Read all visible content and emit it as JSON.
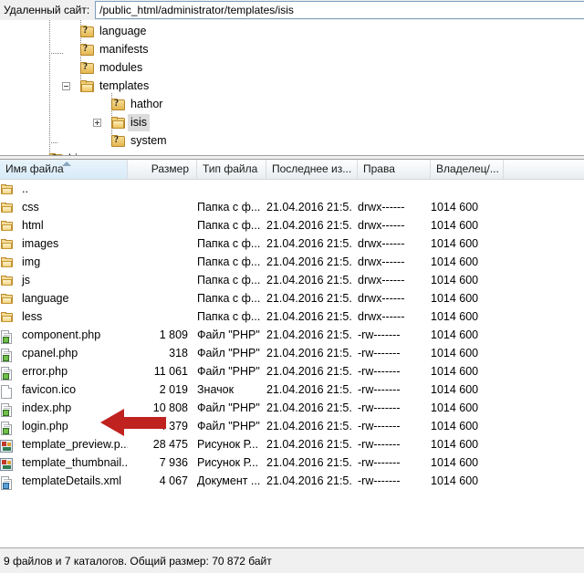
{
  "pathbar": {
    "label": "Удаленный сайт:",
    "value": "/public_html/administrator/templates/isis"
  },
  "tree": {
    "items": [
      {
        "label": "language",
        "icon": "folder-unknown-icon",
        "depth": 2,
        "expander": "none",
        "selected": false
      },
      {
        "label": "manifests",
        "icon": "folder-unknown-icon",
        "depth": 2,
        "expander": "none",
        "selected": false
      },
      {
        "label": "modules",
        "icon": "folder-unknown-icon",
        "depth": 2,
        "expander": "none",
        "selected": false
      },
      {
        "label": "templates",
        "icon": "folder-icon",
        "depth": 2,
        "expander": "minus",
        "selected": false
      },
      {
        "label": "hathor",
        "icon": "folder-unknown-icon",
        "depth": 3,
        "expander": "none",
        "selected": false
      },
      {
        "label": "isis",
        "icon": "folder-icon",
        "depth": 3,
        "expander": "plus",
        "selected": true
      },
      {
        "label": "system",
        "icon": "folder-unknown-icon",
        "depth": 3,
        "expander": "none",
        "selected": false
      },
      {
        "label": "bin",
        "icon": "folder-unknown-icon",
        "depth": 1,
        "expander": "none",
        "selected": false
      }
    ]
  },
  "list": {
    "columns": [
      {
        "key": "name",
        "label": "Имя файла",
        "sorted": true,
        "sort_dir": "asc"
      },
      {
        "key": "size",
        "label": "Размер",
        "sorted": false
      },
      {
        "key": "type",
        "label": "Тип файла",
        "sorted": false
      },
      {
        "key": "date",
        "label": "Последнее из...",
        "sorted": false
      },
      {
        "key": "perm",
        "label": "Права",
        "sorted": false
      },
      {
        "key": "owner",
        "label": "Владелец/...",
        "sorted": false
      }
    ],
    "rows": [
      {
        "icon": "folder-icon",
        "name": "..",
        "size": "",
        "type": "",
        "date": "",
        "perm": "",
        "owner": ""
      },
      {
        "icon": "folder-icon",
        "name": "css",
        "size": "",
        "type": "Папка с ф...",
        "date": "21.04.2016 21:5...",
        "perm": "drwx------",
        "owner": "1014 600"
      },
      {
        "icon": "folder-icon",
        "name": "html",
        "size": "",
        "type": "Папка с ф...",
        "date": "21.04.2016 21:5...",
        "perm": "drwx------",
        "owner": "1014 600"
      },
      {
        "icon": "folder-icon",
        "name": "images",
        "size": "",
        "type": "Папка с ф...",
        "date": "21.04.2016 21:5...",
        "perm": "drwx------",
        "owner": "1014 600"
      },
      {
        "icon": "folder-icon",
        "name": "img",
        "size": "",
        "type": "Папка с ф...",
        "date": "21.04.2016 21:5...",
        "perm": "drwx------",
        "owner": "1014 600"
      },
      {
        "icon": "folder-icon",
        "name": "js",
        "size": "",
        "type": "Папка с ф...",
        "date": "21.04.2016 21:5...",
        "perm": "drwx------",
        "owner": "1014 600"
      },
      {
        "icon": "folder-icon",
        "name": "language",
        "size": "",
        "type": "Папка с ф...",
        "date": "21.04.2016 21:5...",
        "perm": "drwx------",
        "owner": "1014 600"
      },
      {
        "icon": "folder-icon",
        "name": "less",
        "size": "",
        "type": "Папка с ф...",
        "date": "21.04.2016 21:5...",
        "perm": "drwx------",
        "owner": "1014 600"
      },
      {
        "icon": "php-file-icon",
        "name": "component.php",
        "size": "1 809",
        "type": "Файл \"PHP\"",
        "date": "21.04.2016 21:5...",
        "perm": "-rw-------",
        "owner": "1014 600"
      },
      {
        "icon": "php-file-icon",
        "name": "cpanel.php",
        "size": "318",
        "type": "Файл \"PHP\"",
        "date": "21.04.2016 21:5...",
        "perm": "-rw-------",
        "owner": "1014 600"
      },
      {
        "icon": "php-file-icon",
        "name": "error.php",
        "size": "11 061",
        "type": "Файл \"PHP\"",
        "date": "21.04.2016 21:5...",
        "perm": "-rw-------",
        "owner": "1014 600"
      },
      {
        "icon": "blank-file-icon",
        "name": "favicon.ico",
        "size": "2 019",
        "type": "Значок",
        "date": "21.04.2016 21:5...",
        "perm": "-rw-------",
        "owner": "1014 600"
      },
      {
        "icon": "php-file-icon",
        "name": "index.php",
        "size": "10 808",
        "type": "Файл \"PHP\"",
        "date": "21.04.2016 21:5...",
        "perm": "-rw-------",
        "owner": "1014 600"
      },
      {
        "icon": "php-file-icon",
        "name": "login.php",
        "size": "4 379",
        "type": "Файл \"PHP\"",
        "date": "21.04.2016 21:5...",
        "perm": "-rw-------",
        "owner": "1014 600"
      },
      {
        "icon": "image-file-icon",
        "name": "template_preview.p...",
        "size": "28 475",
        "type": "Рисунок Р...",
        "date": "21.04.2016 21:5...",
        "perm": "-rw-------",
        "owner": "1014 600"
      },
      {
        "icon": "image-file-icon",
        "name": "template_thumbnail...",
        "size": "7 936",
        "type": "Рисунок Р...",
        "date": "21.04.2016 21:5...",
        "perm": "-rw-------",
        "owner": "1014 600"
      },
      {
        "icon": "xml-file-icon",
        "name": "templateDetails.xml",
        "size": "4 067",
        "type": "Документ ...",
        "date": "21.04.2016 21:5...",
        "perm": "-rw-------",
        "owner": "1014 600"
      }
    ]
  },
  "annotation": {
    "type": "left-arrow",
    "color": "#c0221f",
    "points_to": "login.php"
  },
  "statusbar": {
    "text": "9 файлов и 7 каталогов. Общий размер: 70 872 байт"
  }
}
